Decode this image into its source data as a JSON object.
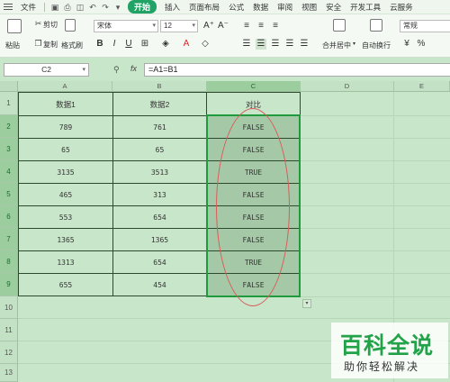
{
  "menu": {
    "file": "文件",
    "quick_access": [
      "save-icon",
      "print-icon",
      "preview-icon",
      "undo-icon",
      "redo-icon",
      "dropdown-icon"
    ],
    "tabs": [
      "开始",
      "插入",
      "页面布局",
      "公式",
      "数据",
      "审阅",
      "视图",
      "安全",
      "开发工具",
      "云服务"
    ],
    "active_tab": "开始",
    "accent_color": "#21a366"
  },
  "ribbon": {
    "paste": "粘贴",
    "cut": "剪切",
    "copy": "复制",
    "format_painter": "格式刷",
    "font_name": "宋体",
    "font_size": "12",
    "bold": "B",
    "italic": "I",
    "underline": "U",
    "font_color_letter": "A",
    "merge_center": "合并居中",
    "auto_wrap": "自动换行",
    "number_format": "常规"
  },
  "formula_bar": {
    "cell_ref": "C2",
    "formula": "=A1=B1",
    "fx": "fx"
  },
  "grid": {
    "columns": [
      "A",
      "B",
      "C",
      "D",
      "E"
    ],
    "rows": [
      "1",
      "2",
      "3",
      "4",
      "5",
      "6",
      "7",
      "8",
      "9",
      "10",
      "11",
      "12",
      "13"
    ],
    "header": [
      "数据1",
      "数据2",
      "对比"
    ],
    "data": [
      [
        "789",
        "761",
        "FALSE"
      ],
      [
        "65",
        "65",
        "FALSE"
      ],
      [
        "3135",
        "3513",
        "TRUE"
      ],
      [
        "465",
        "313",
        "FALSE"
      ],
      [
        "553",
        "654",
        "FALSE"
      ],
      [
        "1365",
        "1365",
        "FALSE"
      ],
      [
        "1313",
        "654",
        "TRUE"
      ],
      [
        "655",
        "454",
        "FALSE"
      ]
    ],
    "selected_col": "C",
    "selected_range": "C2:C9",
    "selection_color": "#1f9a3c",
    "annotation_color": "#d95b5b"
  },
  "watermark": {
    "title": "百科全说",
    "subtitle": "助你轻松解决"
  }
}
